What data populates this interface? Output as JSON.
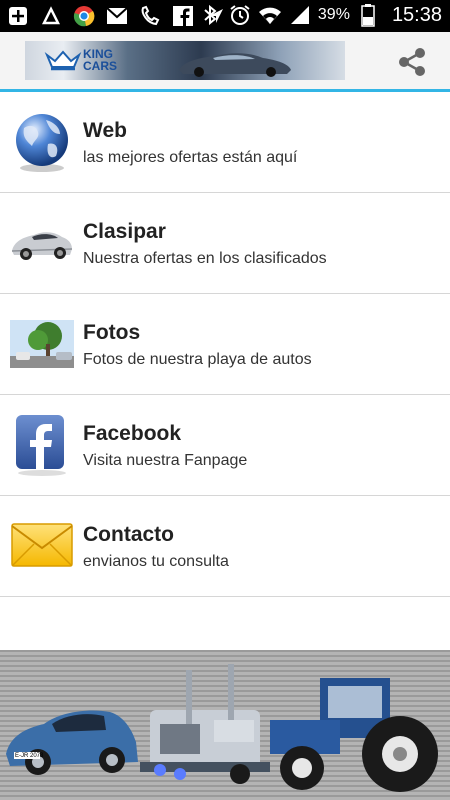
{
  "status_bar": {
    "battery": "39%",
    "time": "15:38",
    "icons": [
      "plus-box-icon",
      "recycle-icon",
      "chrome-icon",
      "gmail-icon",
      "missed-call-icon",
      "facebook-icon",
      "navigation-icon",
      "bluetooth-icon",
      "alarm-icon",
      "wifi-icon",
      "signal-icon",
      "battery-icon"
    ]
  },
  "action_bar": {
    "logo_text_line1": "KING",
    "logo_text_line2": "CARS",
    "share_icon": "share-icon",
    "accent": "#33b5e5"
  },
  "menu": {
    "items": [
      {
        "title": "Web",
        "subtitle": "las mejores ofertas están aquí",
        "icon": "globe-icon"
      },
      {
        "title": "Clasipar",
        "subtitle": "Nuestra ofertas en los clasificados",
        "icon": "sports-car-icon"
      },
      {
        "title": "Fotos",
        "subtitle": "Fotos de nuestra playa de autos",
        "icon": "photo-icon"
      },
      {
        "title": "Facebook",
        "subtitle": "Visita nuestra Fanpage",
        "icon": "facebook-logo-icon"
      },
      {
        "title": "Contacto",
        "subtitle": "envianos tu consulta",
        "icon": "envelope-icon"
      }
    ]
  },
  "footer": {
    "plate": "E-JR 2073",
    "image": "vehicles-banner"
  }
}
